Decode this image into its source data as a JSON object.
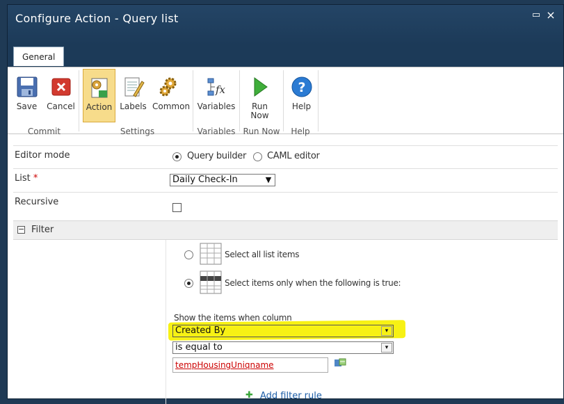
{
  "dialog": {
    "title": "Configure Action - Query list",
    "maximize_glyph": "▭",
    "close_glyph": "×"
  },
  "ribbon": {
    "tab": "General",
    "buttons": {
      "save": "Save",
      "cancel": "Cancel",
      "action": "Action",
      "labels": "Labels",
      "common": "Common",
      "variables": "Variables",
      "run_now_line1": "Run",
      "run_now_line2": "Now",
      "help": "Help"
    },
    "groups": {
      "commit": "Commit",
      "settings": "Settings",
      "variables": "Variables",
      "run_now": "Run Now",
      "help": "Help"
    }
  },
  "form": {
    "editor_mode_label": "Editor mode",
    "query_builder": "Query builder",
    "caml_editor": "CAML editor",
    "list_label": "List",
    "required_mark": "*",
    "list_value": "Daily Check-In",
    "recursive_label": "Recursive",
    "filter_section": "Filter",
    "filter_toggle": "−",
    "select_all": "Select all list items",
    "select_when": "Select items only when the following is true:",
    "show_items_label": "Show the items when column",
    "column_value": "Created By",
    "operator_value": "is equal to",
    "value_text": "tempHousingUniqname",
    "add_filter_rule": "Add filter rule",
    "add_glyph": "✚"
  },
  "colors": {
    "highlight": "#f6f000",
    "accent": "#1c3a58",
    "link": "#cc0000"
  }
}
